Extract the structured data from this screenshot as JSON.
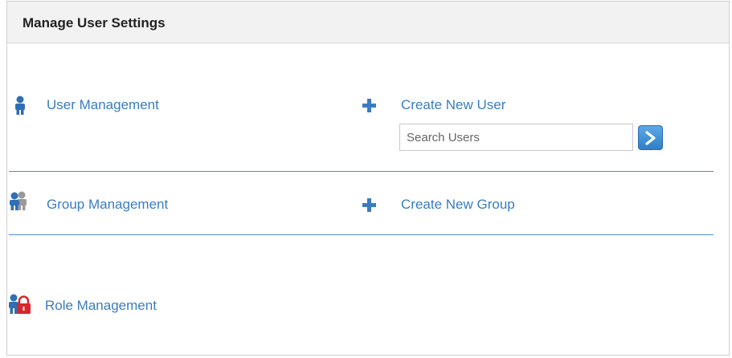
{
  "header": {
    "title": "Manage User Settings"
  },
  "sections": {
    "user": {
      "label": "User Management",
      "create_label": "Create New User",
      "search_placeholder": "Search Users",
      "search_value": ""
    },
    "group": {
      "label": "Group Management",
      "create_label": "Create New Group"
    },
    "role": {
      "label": "Role Management"
    }
  },
  "colors": {
    "link": "#3a7cc1",
    "divider": "#4a90d0",
    "header_bg": "#f2f2f2",
    "lock": "#d9262b"
  },
  "icons": {
    "user": "user-icon",
    "group": "group-icon",
    "role": "role-lock-icon",
    "add": "plus-icon",
    "go": "chevron-right-icon"
  }
}
